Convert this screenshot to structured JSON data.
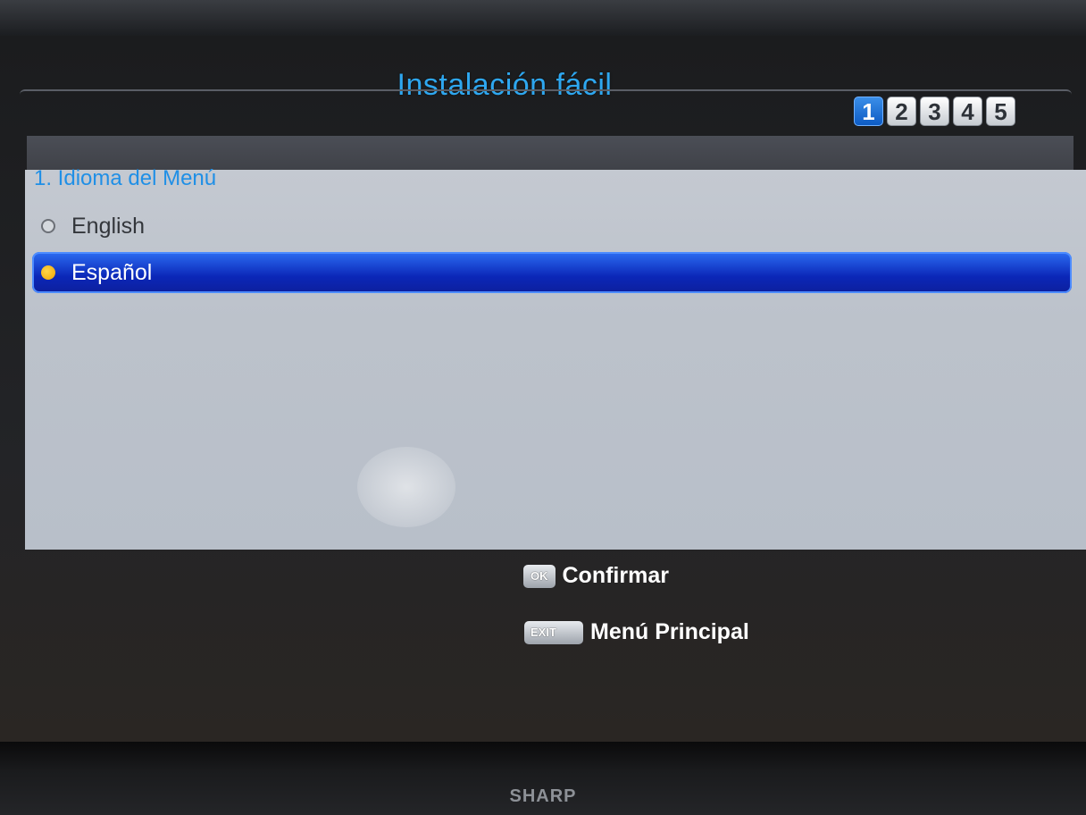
{
  "screen": {
    "title": "Instalación fácil",
    "steps": [
      {
        "label": "1",
        "active": true
      },
      {
        "label": "2",
        "active": false
      },
      {
        "label": "3",
        "active": false
      },
      {
        "label": "4",
        "active": false
      },
      {
        "label": "5",
        "active": false
      }
    ],
    "section_title": "1. Idioma del Menú",
    "options": [
      {
        "label": "English",
        "selected": false
      },
      {
        "label": "Español",
        "selected": true
      }
    ],
    "footer": {
      "ok_key": "OK",
      "ok_label": "Confirmar",
      "exit_key": "EXIT",
      "exit_label": "Menú Principal"
    }
  },
  "tv": {
    "brand": "SHARP"
  },
  "colors": {
    "title": "#2ea7f0",
    "selection": "#0b27b8",
    "panel": "#bcc2cb",
    "radio_checked": "#f0a500"
  }
}
